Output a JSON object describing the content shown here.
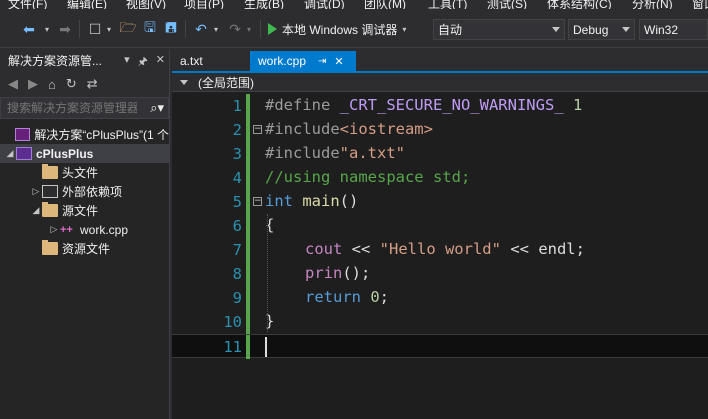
{
  "menu": [
    "文件(F)",
    "编辑(E)",
    "视图(V)",
    "项目(P)",
    "生成(B)",
    "调试(D)",
    "团队(M)",
    "工具(T)",
    "测试(S)",
    "体系结构(C)",
    "分析(N)",
    "窗口"
  ],
  "toolbar": {
    "run_label": "本地 Windows 调试器",
    "run_dropdown_value": "自动",
    "config_value": "Debug",
    "platform_value": "Win32"
  },
  "solution_explorer": {
    "title": "解决方案资源管...",
    "search_placeholder": "搜索解决方案资源管理器",
    "items": [
      {
        "label": "解决方案“cPlusPlus”(1 个",
        "icon": "solution-icon",
        "expanded": false
      },
      {
        "label": "cPlusPlus",
        "icon": "project-icon",
        "expanded": true,
        "selected": true
      },
      {
        "label": "头文件",
        "icon": "folder-icon"
      },
      {
        "label": "外部依赖项",
        "icon": "external-deps-icon"
      },
      {
        "label": "源文件",
        "icon": "folder-icon",
        "expanded": true
      },
      {
        "label": "work.cpp",
        "icon": "cpp-file-icon"
      },
      {
        "label": "资源文件",
        "icon": "folder-icon"
      }
    ]
  },
  "editor": {
    "tabs": [
      {
        "label": "a.txt",
        "active": false
      },
      {
        "label": "work.cpp",
        "active": true
      }
    ],
    "scope_label": "(全局范围)",
    "line_numbers": [
      "1",
      "2",
      "3",
      "4",
      "5",
      "6",
      "7",
      "8",
      "9",
      "10",
      "11"
    ],
    "lines": {
      "l1_a": "#define ",
      "l1_b": "_CRT_SECURE_NO_WARNINGS_",
      "l1_c": " 1",
      "l2_a": "#include",
      "l2_b": "<iostream>",
      "l3_a": "#include",
      "l3_b": "\"a.txt\"",
      "l4": "//using namespace std;",
      "l5_a": "int ",
      "l5_b": "main",
      "l5_c": "()",
      "l6": "{",
      "l7_a": "cout",
      "l7_b": " << ",
      "l7_c": "\"Hello world\"",
      "l7_d": " << ",
      "l7_e": "endl",
      "l7_f": ";",
      "l8_a": "prin",
      "l8_b": "();",
      "l9_a": "return",
      "l9_b": " 0",
      "l9_c": ";",
      "l10": "}"
    }
  }
}
